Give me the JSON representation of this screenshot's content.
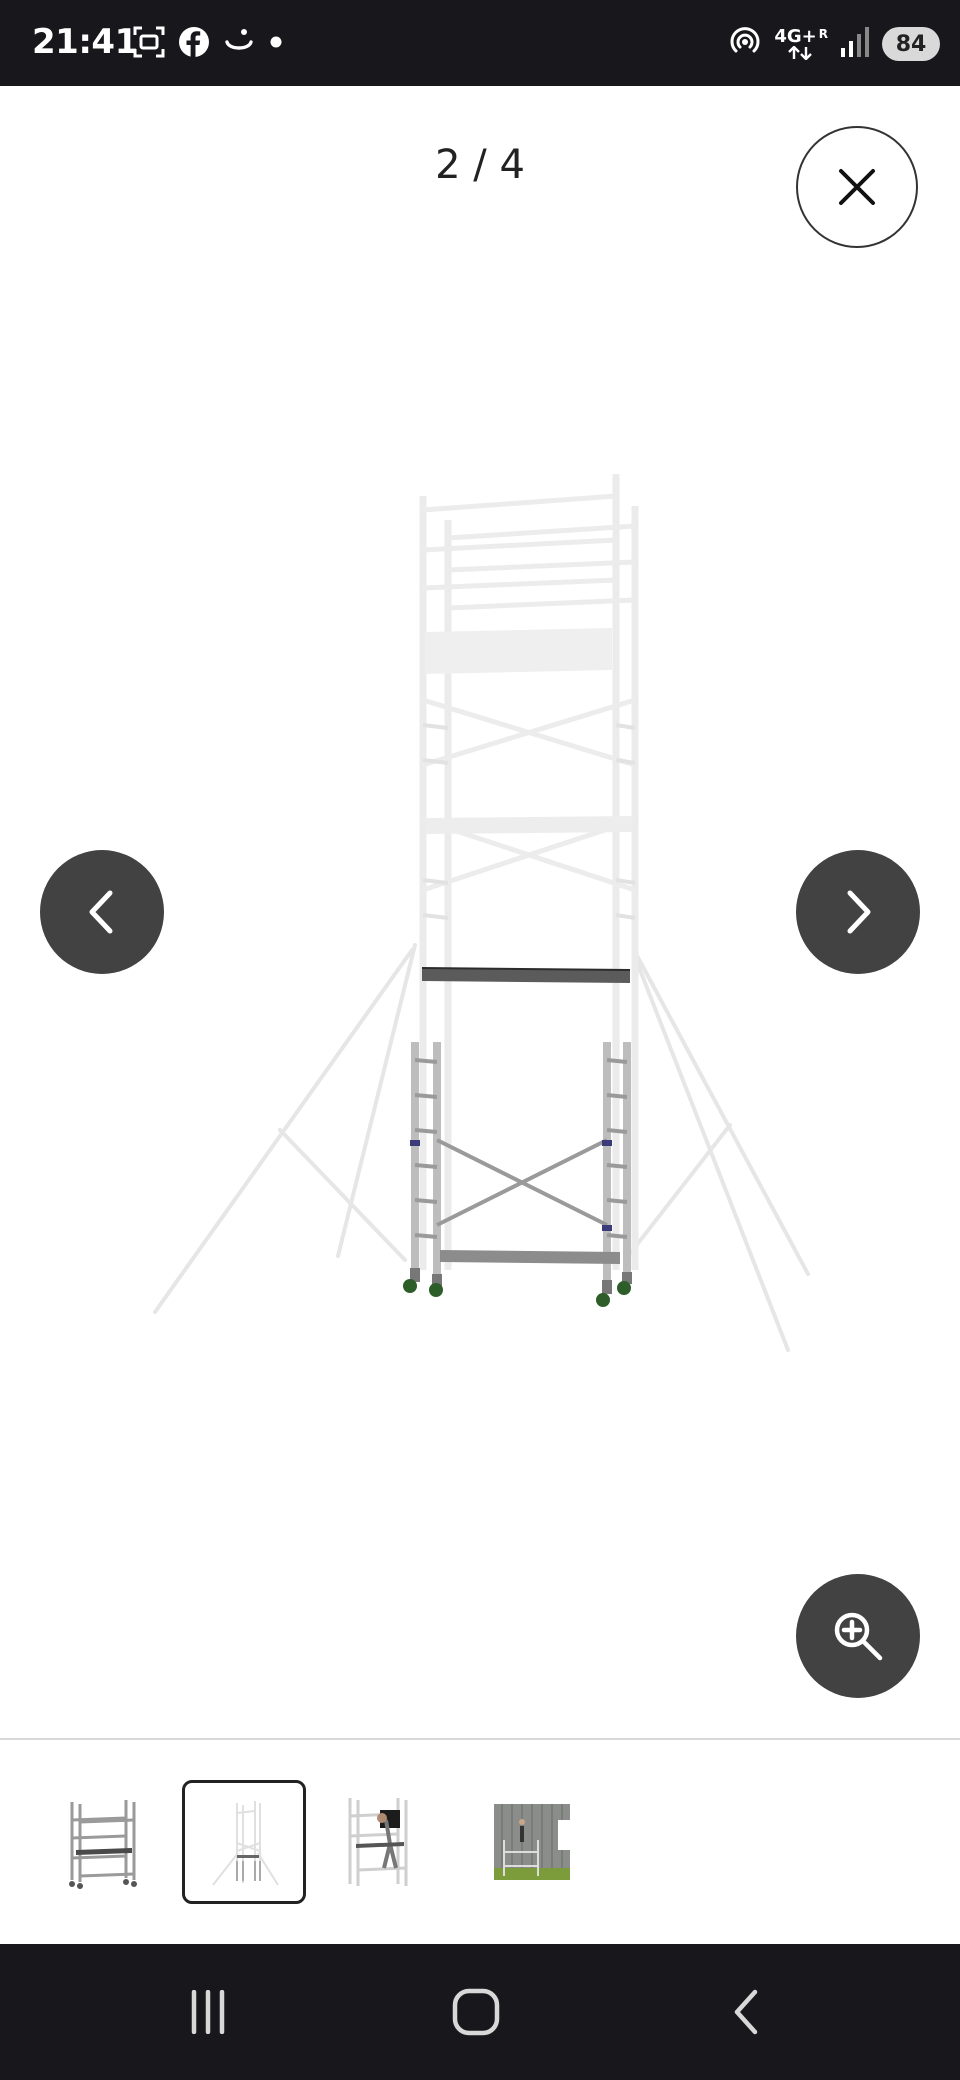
{
  "status_bar": {
    "time": "21:41",
    "left_icons": [
      "screenshot-icon",
      "facebook-icon",
      "smile-icon",
      "dot-icon"
    ],
    "network": "4G+",
    "roaming": "R",
    "battery": "84"
  },
  "viewer": {
    "counter": "2 / 4",
    "current_index": 2,
    "total": 4,
    "buttons": [
      "close-icon",
      "chevron-left-icon",
      "chevron-right-icon",
      "zoom-in-icon"
    ]
  },
  "main_image": {
    "subject": "mobile aluminium scaffold tower with outriggers"
  },
  "thumbnails": [
    {
      "subject": "small scaffold",
      "selected": false
    },
    {
      "subject": "tall scaffold tower",
      "selected": true
    },
    {
      "subject": "scaffold with person",
      "selected": false
    },
    {
      "subject": "scaffold in use on building",
      "selected": false
    }
  ],
  "colors": {
    "status_bar": "#18181c",
    "nav_button": "#424242",
    "background": "#ffffff"
  }
}
